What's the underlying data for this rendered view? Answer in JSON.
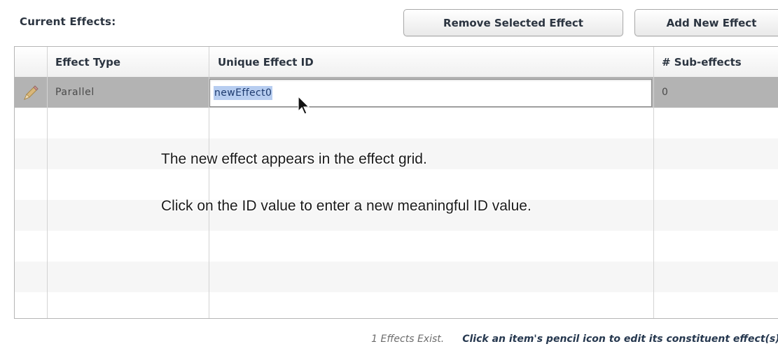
{
  "panel": {
    "title": "Current Effects:",
    "remove_button_label": "Remove Selected Effect",
    "add_button_label": "Add New Effect"
  },
  "grid": {
    "columns": [
      "",
      "Effect Type",
      "Unique Effect ID",
      "# Sub-effects"
    ],
    "rows": [
      {
        "edit_icon": "pencil-icon",
        "effect_type": "Parallel",
        "unique_id": "newEffect0",
        "sub_effects": "0",
        "selected": true
      }
    ]
  },
  "overlay": {
    "line1": "The new effect appears in the effect grid.",
    "line2": "Click on the ID value to enter a new meaningful ID value."
  },
  "footer": {
    "count_text": "1 Effects Exist.",
    "hint_text": "Click an item's pencil icon to edit its constituent effect(s)."
  },
  "colors": {
    "selected_row": "#b3b3b3",
    "text_selection": "#b7cdf0",
    "hint_text": "#26384f"
  }
}
